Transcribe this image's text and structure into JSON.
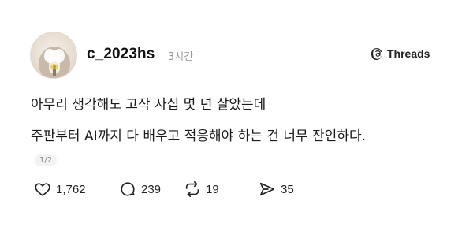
{
  "post": {
    "username": "c_2023hs",
    "time": "3시간",
    "brand": "Threads",
    "lines": [
      "아무리 생각해도 고작 사십 몇 년 살았는데",
      "주판부터 AI까지 다 배우고 적응해야 하는 건 너무 잔인하다."
    ],
    "pager": "1/2",
    "stats": {
      "likes": "1,762",
      "comments": "239",
      "reposts": "19",
      "shares": "35"
    }
  },
  "icons": {
    "avatar": "avatar-photo",
    "brand": "threads-logo-icon",
    "like": "heart-icon",
    "comment": "comment-bubble-icon",
    "repost": "repost-icon",
    "share": "send-icon"
  }
}
